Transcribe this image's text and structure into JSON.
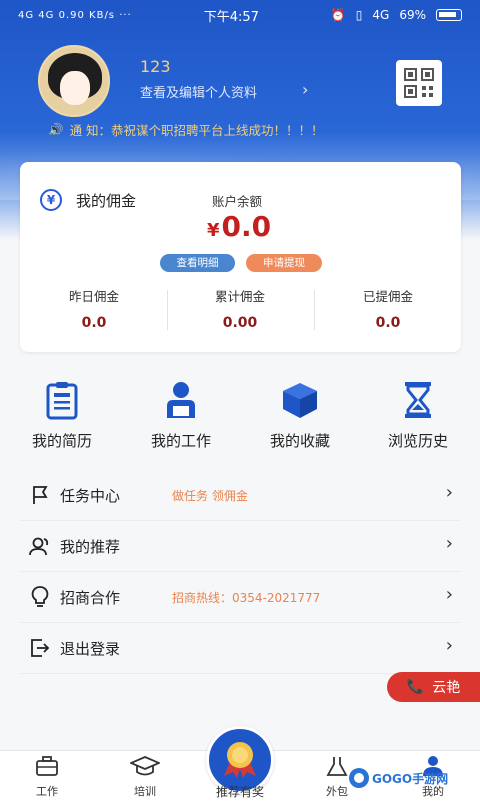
{
  "status_bar": {
    "network": "4G 4G 0.90 KB/s ···",
    "time": "下午4:57",
    "icons": [
      "alarm-icon",
      "vibrate-icon",
      "signal-4g-icon"
    ],
    "network_right": "4G",
    "battery": "69%"
  },
  "profile": {
    "username": "123",
    "edit_link": "查看及编辑个人资料",
    "qr_icon": "qr-code-icon"
  },
  "notice": {
    "icon": "speaker-icon",
    "text": "通 知：恭祝谋个职招聘平台上线成功！！！！"
  },
  "commission": {
    "title": "我的佣金",
    "balance_label": "账户余额",
    "currency": "¥",
    "balance": "0.0",
    "detail_button": "查看明细",
    "withdraw_button": "申请提现",
    "stats": [
      {
        "label": "昨日佣金",
        "value": "0.0"
      },
      {
        "label": "累计佣金",
        "value": "0.00"
      },
      {
        "label": "已提佣金",
        "value": "0.0"
      }
    ]
  },
  "shortcuts": [
    {
      "label": "我的简历",
      "icon": "resume-icon"
    },
    {
      "label": "我的工作",
      "icon": "work-icon"
    },
    {
      "label": "我的收藏",
      "icon": "box-icon"
    },
    {
      "label": "浏览历史",
      "icon": "hourglass-icon"
    }
  ],
  "menu": [
    {
      "label": "任务中心",
      "desc": "做任务 领佣金",
      "icon": "flag-icon"
    },
    {
      "label": "我的推荐",
      "desc": "",
      "icon": "users-icon"
    },
    {
      "label": "招商合作",
      "desc": "招商热线：0354-2021777",
      "icon": "lightbulb-icon"
    },
    {
      "label": "退出登录",
      "desc": "",
      "icon": "logout-icon"
    }
  ],
  "service_button": "云艳",
  "tabbar": {
    "tabs": [
      {
        "label": "工作",
        "icon": "briefcase-icon"
      },
      {
        "label": "培训",
        "icon": "graduation-cap-icon"
      },
      {
        "label": "外包",
        "icon": "flask-icon"
      },
      {
        "label": "我的",
        "icon": "person-icon"
      }
    ],
    "center_label": "推荐有奖",
    "center_icon": "medal-icon"
  },
  "watermark": "GOGO手游网",
  "colors": {
    "primary_blue": "#1f56c7",
    "balance_red": "#c41e1e",
    "accent_orange": "#e9844d",
    "service_red": "#d8362f"
  }
}
